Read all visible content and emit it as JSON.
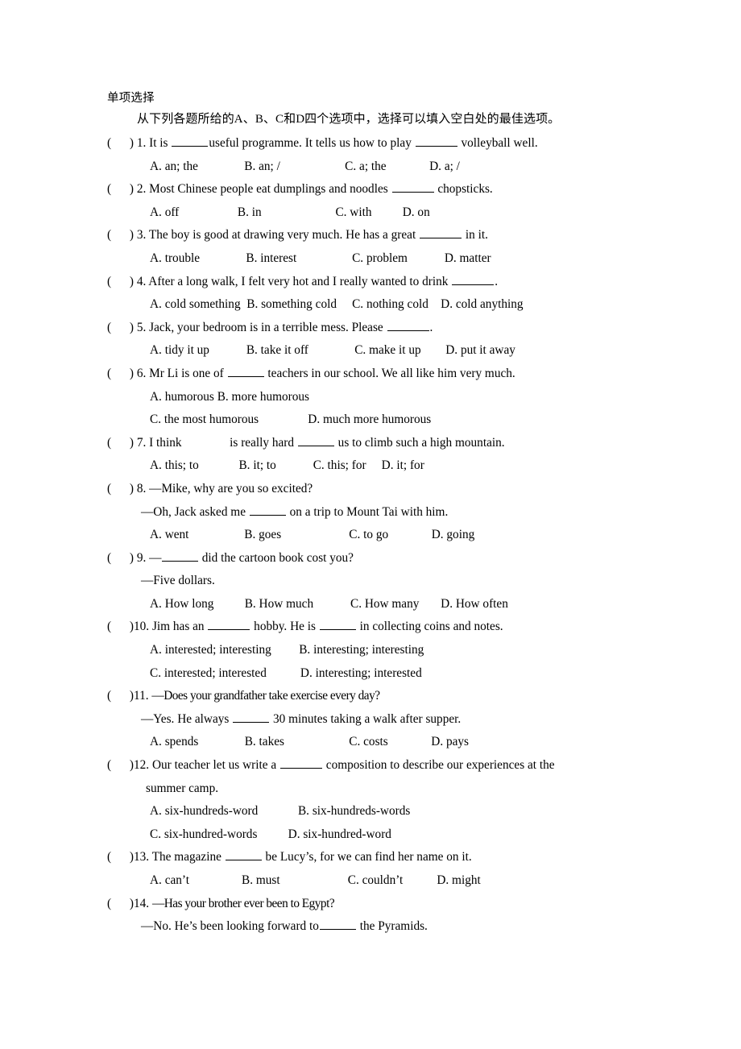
{
  "document": {
    "section_title": "单项选择",
    "instruction": "从下列各题所给的A、B、C和D四个选项中，选择可以填入空白处的最佳选项。",
    "paren_open": "(",
    "paren_close": ")"
  },
  "questions": [
    {
      "number": "1.",
      "stem_parts": [
        "It is ",
        "useful programme. It tells us how to play ",
        " volleyball well."
      ],
      "options_line_1": "A. an; the               B. an; /                     C. a; the              D. a; /"
    },
    {
      "number": "2.",
      "stem_parts": [
        "Most Chinese people eat dumplings and noodles ",
        " chopsticks."
      ],
      "options_line_1": "A. off                   B. in                        C. with          D. on"
    },
    {
      "number": "3.",
      "stem_parts": [
        "The boy is good at drawing very much. He has a great ",
        " in it."
      ],
      "options_line_1": "A. trouble               B. interest                  C. problem            D. matter"
    },
    {
      "number": "4.",
      "stem_parts": [
        "After a long walk, I felt very hot and I really wanted to drink ",
        "."
      ],
      "options_line_1": "A. cold something  B. something cold     C. nothing cold    D. cold anything"
    },
    {
      "number": "5.",
      "stem_parts": [
        "Jack, your bedroom is in a terrible mess. Please ",
        "."
      ],
      "options_line_1": "A. tidy it up            B. take it off               C. make it up        D. put it away"
    },
    {
      "number": "6.",
      "stem_parts": [
        "Mr Li is one of ",
        " teachers in our school. We all like him very much."
      ],
      "options_line_1": "A. humorous B. more humorous",
      "options_line_2": "C. the most humorous                D. much more humorous"
    },
    {
      "number": "7.",
      "stem_parts": [
        "I think ",
        " is really hard ",
        " us to climb such a high mountain."
      ],
      "options_line_1": "A. this; to             B. it; to            C. this; for     D. it; for"
    },
    {
      "number": "8.",
      "stem_parts": [
        "—Mike, why are you so excited?"
      ],
      "reply_parts": [
        "—Oh, Jack asked me ",
        " on a trip to Mount Tai with him."
      ],
      "options_line_1": "A. went                  B. goes                      C. to go              D. going"
    },
    {
      "number": "9.",
      "stem_parts": [
        "—",
        " did the cartoon book cost you?"
      ],
      "reply_parts": [
        "—Five dollars."
      ],
      "options_line_1": "A. How long          B. How much            C. How many       D. How often"
    },
    {
      "number": "10.",
      "stem_parts": [
        "Jim has an ",
        " hobby. He is ",
        "  in collecting coins and notes."
      ],
      "options_line_1": "A. interested; interesting         B. interesting; interesting",
      "options_line_2": "C. interested; interested           D. interesting; interested"
    },
    {
      "number": "11.",
      "stem_parts": [
        "—Does your grandfather take exercise every day?"
      ],
      "reply_parts": [
        "—Yes. He always ",
        " 30 minutes taking a walk after supper."
      ],
      "options_line_1": "A. spends               B. takes                     C. costs              D. pays"
    },
    {
      "number": "12.",
      "stem_parts": [
        "Our teacher let us write a ",
        "  composition to describe our experiences at the"
      ],
      "continuation": "summer camp.",
      "options_line_1": "A. six-hundreds-word             B. six-hundreds-words",
      "options_line_2": "C. six-hundred-words          D. six-hundred-word"
    },
    {
      "number": "13.",
      "stem_parts": [
        "The magazine ",
        " be Lucy’s, for we can find her name on it."
      ],
      "options_line_1": "A. can’t                 B. must                      C. couldn’t           D. might"
    },
    {
      "number": "14.",
      "stem_parts": [
        "—Has your brother ever been to Egypt?"
      ],
      "reply_parts": [
        "—No. He’s been looking forward to",
        " the Pyramids."
      ]
    }
  ]
}
